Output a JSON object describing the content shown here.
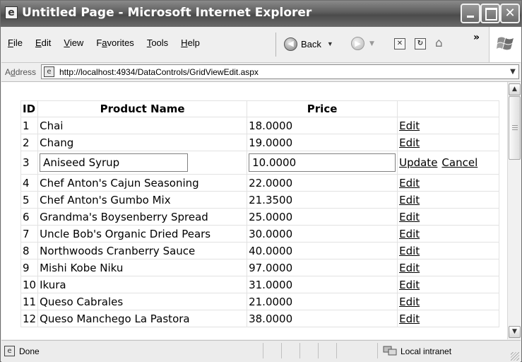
{
  "window": {
    "title": "Untitled Page - Microsoft Internet Explorer",
    "controls": {
      "minimize": "_",
      "maximize": "□",
      "close": "✕"
    }
  },
  "menu": {
    "items": [
      {
        "accel": "F",
        "rest": "ile"
      },
      {
        "accel": "E",
        "rest": "dit"
      },
      {
        "accel": "V",
        "rest": "iew"
      },
      {
        "pre": "F",
        "accel": "a",
        "rest": "vorites"
      },
      {
        "accel": "T",
        "rest": "ools"
      },
      {
        "accel": "H",
        "rest": "elp"
      }
    ],
    "back_label": "Back",
    "chevrons": "»"
  },
  "address": {
    "label_pre": "A",
    "label_accel": "d",
    "label_rest": "dress",
    "url": "http://localhost:4934/DataControls/GridViewEdit.aspx"
  },
  "grid": {
    "headers": {
      "id": "ID",
      "name": "Product Name",
      "price": "Price"
    },
    "rows": [
      {
        "id": "1",
        "name": "Chai",
        "price": "18.0000",
        "action": "Edit"
      },
      {
        "id": "2",
        "name": "Chang",
        "price": "19.0000",
        "action": "Edit"
      },
      {
        "id": "3",
        "name": "Aniseed Syrup",
        "price": "10.0000",
        "update": "Update",
        "cancel": "Cancel",
        "editing": true
      },
      {
        "id": "4",
        "name": "Chef Anton's Cajun Seasoning",
        "price": "22.0000",
        "action": "Edit"
      },
      {
        "id": "5",
        "name": "Chef Anton's Gumbo Mix",
        "price": "21.3500",
        "action": "Edit"
      },
      {
        "id": "6",
        "name": "Grandma's Boysenberry Spread",
        "price": "25.0000",
        "action": "Edit"
      },
      {
        "id": "7",
        "name": "Uncle Bob's Organic Dried Pears",
        "price": "30.0000",
        "action": "Edit"
      },
      {
        "id": "8",
        "name": "Northwoods Cranberry Sauce",
        "price": "40.0000",
        "action": "Edit"
      },
      {
        "id": "9",
        "name": "Mishi Kobe Niku",
        "price": "97.0000",
        "action": "Edit"
      },
      {
        "id": "10",
        "name": "Ikura",
        "price": "31.0000",
        "action": "Edit"
      },
      {
        "id": "11",
        "name": "Queso Cabrales",
        "price": "21.0000",
        "action": "Edit"
      },
      {
        "id": "12",
        "name": "Queso Manchego La Pastora",
        "price": "38.0000",
        "action": "Edit"
      }
    ]
  },
  "status": {
    "text": "Done",
    "zone": "Local intranet"
  },
  "icons": {
    "page": "page-icon",
    "globe": "local-intranet-icon",
    "windows_logo": "windows-logo-icon"
  }
}
